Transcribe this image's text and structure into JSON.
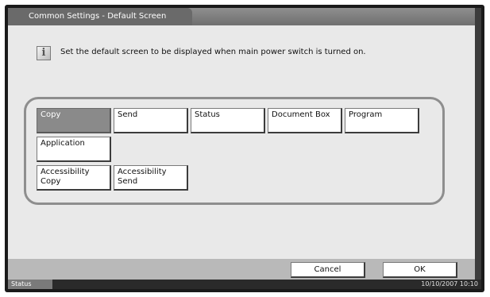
{
  "title": "Common Settings - Default Screen",
  "message": "Set the default screen to be displayed when main power switch is turned on.",
  "info_icon": "info-icon",
  "options": [
    {
      "label": "Copy",
      "selected": true
    },
    {
      "label": "Send",
      "selected": false
    },
    {
      "label": "Status",
      "selected": false
    },
    {
      "label": "Document Box",
      "selected": false
    },
    {
      "label": "Program",
      "selected": false
    },
    {
      "label": "Application",
      "selected": false
    },
    {
      "label": "Accessibility\nCopy",
      "selected": false
    },
    {
      "label": "Accessibility\nSend",
      "selected": false
    }
  ],
  "buttons": {
    "cancel": "Cancel",
    "ok": "OK"
  },
  "status_bar": {
    "status": "Status",
    "datetime": "10/10/2007   10:10"
  }
}
